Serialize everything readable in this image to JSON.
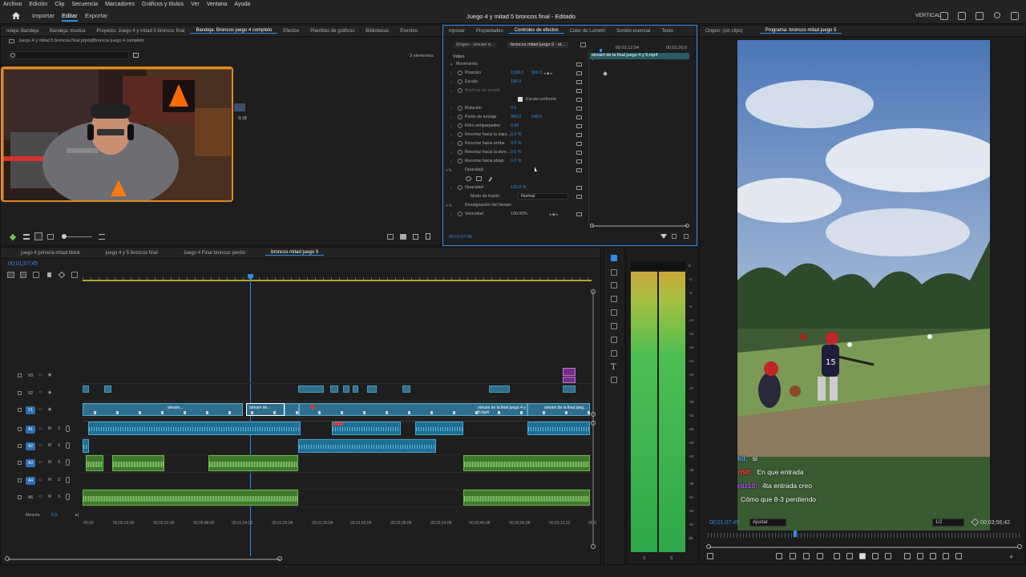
{
  "menu": [
    "Archivo",
    "Edición",
    "Clip",
    "Secuencia",
    "Marcadores",
    "Gráficos y títulos",
    "Ver",
    "Ventana",
    "Ayuda"
  ],
  "topbar": {
    "nav": [
      "Importar",
      "Editar",
      "Exportar"
    ],
    "title": "Juego 4 y mitad 5 broncos final - Editado",
    "workspace": "VERTICAL"
  },
  "project": {
    "tabs": [
      "ndeja: Bandeja",
      "Bandeja: musica",
      "Proyecto: Juego 4 y mitad 5 broncos final",
      "Bandeja: Broncos juego 4 completo",
      "Efectos",
      "Plantillas de gráficos",
      "Bibliotecas",
      "Eventos"
    ],
    "path": "Juego 4 y mitad 5 broncos final.prproj\\Broncos juego 4 completo",
    "count": "3 elementos",
    "thumb_duration": "0;18"
  },
  "effects": {
    "tabs": [
      "mposer",
      "Propiedades",
      "Controles de efectos",
      "Color de Lumetri",
      "Sonido esencial",
      "Texto"
    ],
    "source_sel": "Origen - stream d...",
    "clip_sel": "broncos mitad juego 5 - st...",
    "timecode_a": "00;01;12;04",
    "timecode_b": "00;01;20;0",
    "clip_label": "stream de la final juego 4 y 5.mp4",
    "section_video": "Vídeo",
    "rows": [
      {
        "label": "Movimiento",
        "v1": "",
        "v2": ""
      },
      {
        "label": "Posición",
        "v1": "1538.0",
        "v2": "960.0"
      },
      {
        "label": "Escala",
        "v1": "180.0",
        "v2": ""
      },
      {
        "label": "Anchura de escala",
        "v1": "",
        "v2": ""
      },
      {
        "label": "Escala uniforme",
        "v1": "",
        "v2": ""
      },
      {
        "label": "Rotación",
        "v1": "0.0",
        "v2": ""
      },
      {
        "label": "Punto de anclaje",
        "v1": "960.0",
        "v2": "540.0"
      },
      {
        "label": "Filtro antiparpadeo",
        "v1": "0.00",
        "v2": ""
      },
      {
        "label": "Recortar hacia la izqui...",
        "v1": "0.0 %",
        "v2": ""
      },
      {
        "label": "Recortar hacia arriba",
        "v1": "0.0 %",
        "v2": ""
      },
      {
        "label": "Recortar hacia la dere...",
        "v1": "0.0 %",
        "v2": ""
      },
      {
        "label": "Recortar hacia abajo",
        "v1": "0.0 %",
        "v2": ""
      },
      {
        "label": "Opacidad",
        "v1": "",
        "v2": ""
      },
      {
        "label": "",
        "v1": "",
        "v2": ""
      },
      {
        "label": "Opacidad",
        "v1": "100.0 %",
        "v2": ""
      },
      {
        "label": "Modo de fusión",
        "v1": "Normal",
        "v2": ""
      },
      {
        "label": "Reasignación del tiempo",
        "v1": "",
        "v2": ""
      },
      {
        "label": "Velocidad",
        "v1": "100.00%",
        "v2": ""
      }
    ],
    "footer_time": "00;01;07;45"
  },
  "source_monitor": {
    "tab": "Origen: (sin clips)"
  },
  "program": {
    "tab": "Programa: broncos mitad juego 5",
    "timecode": "00;01;07;45",
    "fit": "Ajustar",
    "quality": "1/2",
    "duration": "00;03;56;42",
    "chat": [
      {
        "user": "kd:",
        "text": "si",
        "color": "#5a9cff"
      },
      {
        "user": "rt98:",
        "text": "En que entrada",
        "color": "#ff3b3b"
      },
      {
        "user": "rdz10:",
        "text": "4ta entrada creo",
        "color": "#b64cff"
      },
      {
        "user": "",
        "text": "Cómo que 8-3 perdiendo",
        "color": "#ffffff"
      }
    ]
  },
  "timeline": {
    "tabs": [
      "juego 4 primera mitad tiktok",
      "juego 4 y 5 broncos final",
      "Juego 4 Final broncos perdio",
      "broncos mitad juego 5"
    ],
    "timecode": "00;01;07;45",
    "ruler": [
      "00;00",
      "00;00;16;00",
      "00;00;32;00",
      "00;00;48;00",
      "00;01;04;00",
      "00;01;20;04",
      "00;01;36;04",
      "00;01;52;04",
      "00;02;08;08",
      "00;02;24;08",
      "00;02;40;08",
      "00;02;56;08",
      "00;03;12;12",
      "00;0"
    ],
    "tracks": [
      {
        "name": "V3"
      },
      {
        "name": "V2"
      },
      {
        "name": "V1"
      },
      {
        "name": "A1"
      },
      {
        "name": "A2"
      },
      {
        "name": "A3"
      },
      {
        "name": "A4"
      },
      {
        "name": "A5"
      }
    ],
    "mix_label": "Mezcla",
    "mix_value": "0.0",
    "clip_names": [
      "stream...",
      "stream de...",
      "stream de la final juego 4 y 5.mp4",
      "stream de la final jueg..."
    ]
  },
  "meter_scale": [
    "0",
    "-3",
    "-6",
    "-9",
    "-12",
    "-15",
    "-18",
    "-21",
    "-24",
    "-27",
    "-30",
    "-33",
    "-36",
    "-39",
    "-42",
    "-45",
    "-48",
    "-51",
    "-54",
    "-57",
    "dB"
  ],
  "meter_solo": [
    "S",
    "S"
  ]
}
